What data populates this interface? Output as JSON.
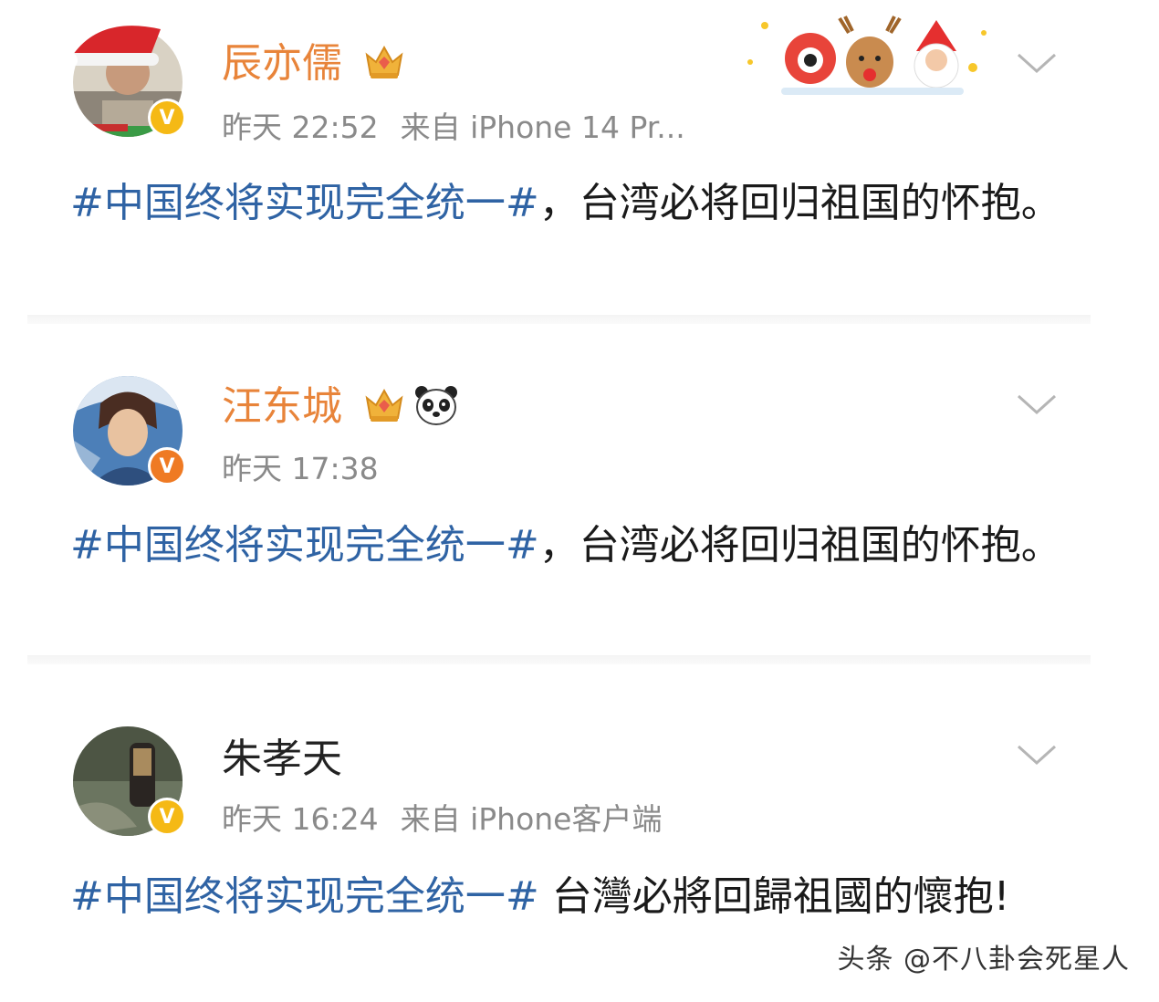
{
  "posts": [
    {
      "username": "辰亦儒",
      "time": "昨天 22:52",
      "source": "来自 iPhone 14 Pr...",
      "hashtag": "#中国终将实现完全统一#",
      "text": "，台湾必将回归祖国的怀抱。"
    },
    {
      "username": "汪东城",
      "time": "昨天 17:38",
      "hashtag": "#中国终将实现完全统一#",
      "text": "，台湾必将回归祖国的怀抱。"
    },
    {
      "username": "朱孝天",
      "time": "昨天 16:24",
      "source": "来自 iPhone客户端",
      "hashtag": "#中国终将实现完全统一#",
      "text": " 台灣必將回歸祖國的懷抱!"
    }
  ],
  "badge_letter": "V",
  "icons": {
    "verified": "verified-v-icon",
    "crown": "crown-icon",
    "panda": "panda-icon",
    "more": "chevron-down-icon",
    "banner": "christmas-banner"
  },
  "colors": {
    "vip_name": "#e8843a",
    "hashtag": "#2f63a4",
    "meta": "#8a8a8a",
    "badge_gold": "#f5b915",
    "badge_orange": "#ef7a23"
  },
  "watermark": "头条 @不八卦会死星人"
}
